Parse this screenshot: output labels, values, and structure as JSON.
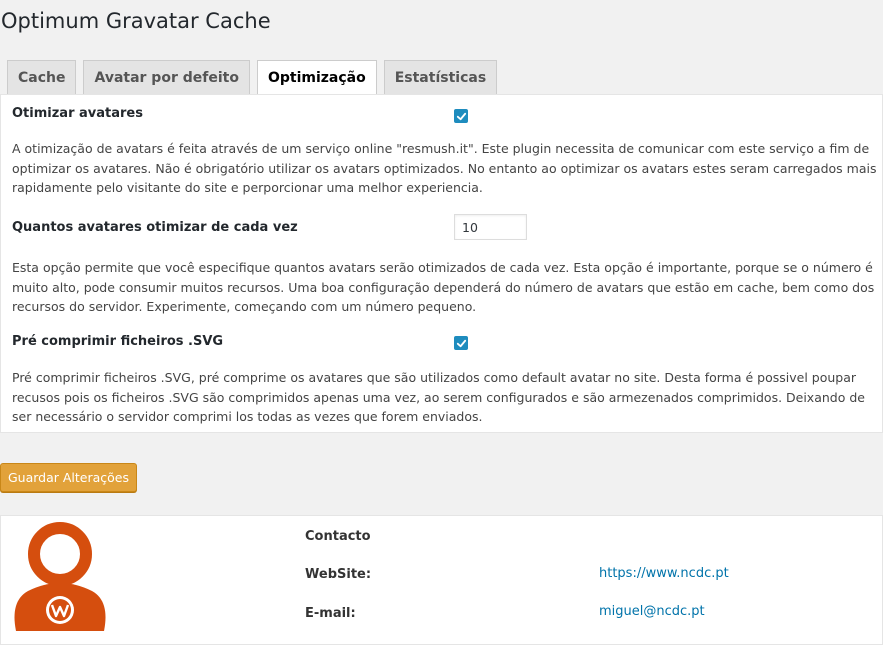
{
  "page": {
    "title": "Optimum Gravatar Cache"
  },
  "tabs": [
    {
      "label": "Cache"
    },
    {
      "label": "Avatar por defeito"
    },
    {
      "label": "Optimização",
      "active": true
    },
    {
      "label": "Estatísticas"
    }
  ],
  "options": {
    "optimize": {
      "label": "Otimizar avatares",
      "checked": true,
      "description": "A otimização de avatars é feita através de um serviço online \"resmush.it\". Este plugin necessita de comunicar com este serviço a fim de optimizar os avatares. Não é obrigatório utilizar os avatars optimizados. No entanto ao optimizar os avatars estes seram carregados mais rapidamente pelo visitante do site e perporcionar uma melhor experiencia."
    },
    "batch": {
      "label": "Quantos avatares otimizar de cada vez",
      "value": "10",
      "description": "Esta opção permite que você especifique quantos avatars serão otimizados de cada vez. Esta opção é importante, porque se o número é muito alto, pode consumir muitos recursos. Uma boa configuração dependerá do número de avatars que estão em cache, bem como dos recursos do servidor. Experimente, começando com um número pequeno."
    },
    "svg": {
      "label": "Pré comprimir ficheiros .SVG",
      "checked": true,
      "description": "Pré comprimir ficheiros .SVG, pré comprime os avatares que são utilizados como default avatar no site. Desta forma é possivel poupar recusos pois os ficheiros .SVG são comprimidos apenas uma vez, ao serem configurados e são armezenados comprimidos. Deixando de ser necessário o servidor comprimi los todas as vezes que forem enviados."
    }
  },
  "actions": {
    "save_label": "Guardar Alterações"
  },
  "contact": {
    "heading": "Contacto",
    "website_label": "WebSite:",
    "website_value": "https://www.ncdc.pt",
    "email_label": "E-mail:",
    "email_value": "miguel@ncdc.pt"
  },
  "colors": {
    "accent": "#1e8cbe",
    "button": "#e2a23a",
    "avatar": "#d54e0e",
    "link": "#0073aa"
  },
  "icons": {
    "checkbox": "checkmark-icon",
    "avatar": "user-avatar-icon",
    "logo": "wordpress-logo-icon"
  }
}
